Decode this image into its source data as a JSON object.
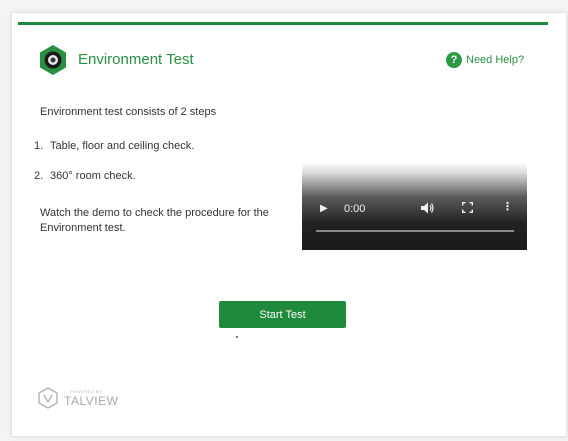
{
  "header": {
    "title": "Environment Test",
    "help_label": "Need Help?",
    "help_icon": "?"
  },
  "content": {
    "intro": "Environment test consists of 2 steps",
    "steps": [
      {
        "number": "1.",
        "text": "Table, floor and ceiling check."
      },
      {
        "number": "2.",
        "text": "360° room check."
      }
    ],
    "watch_text": "Watch the demo to check the procedure for the Environment test."
  },
  "video": {
    "time": "0:00",
    "play_icon": "▶",
    "volume_icon": "🔊",
    "fullscreen_icon": "⛶",
    "more_icon": "⋮"
  },
  "actions": {
    "start_label": "Start Test"
  },
  "footer": {
    "powered_by": "POWERED BY",
    "brand": "TALVIEW"
  },
  "colors": {
    "accent": "#1f8a3b",
    "title": "#2a8f44"
  }
}
